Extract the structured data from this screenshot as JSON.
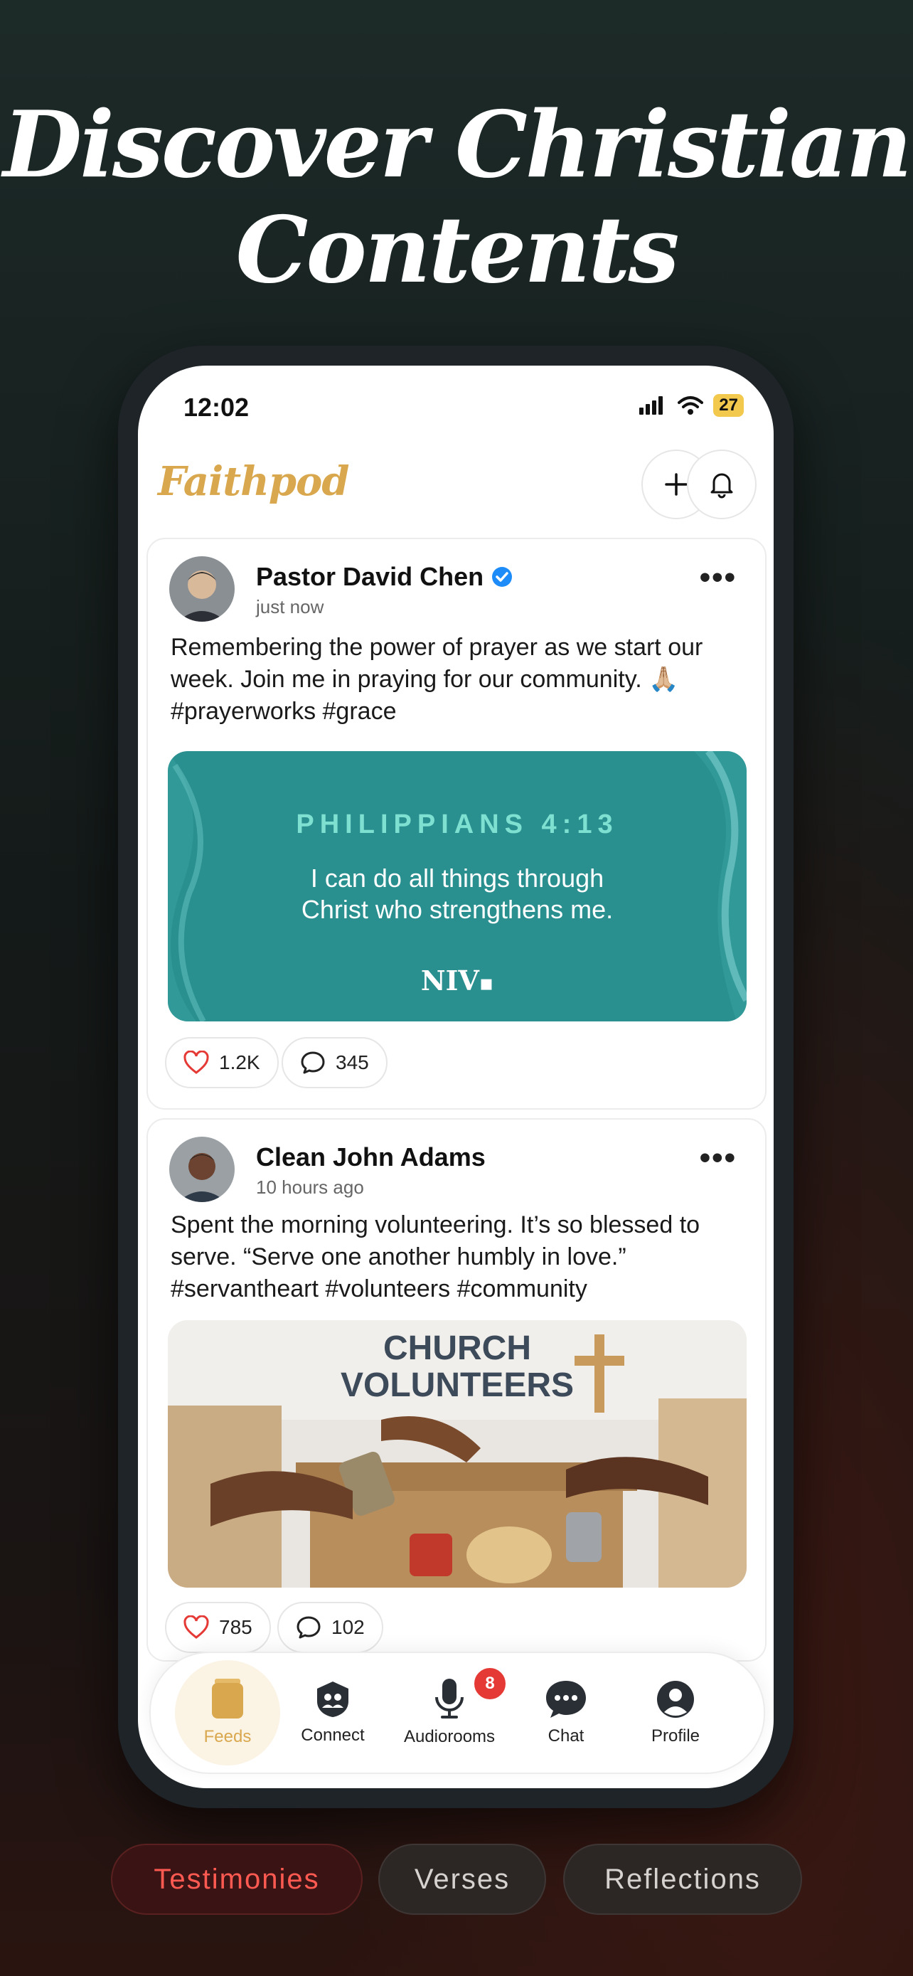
{
  "headline": {
    "line1": "Discover Christian",
    "line2": "Contents"
  },
  "status_bar": {
    "time": "12:02",
    "battery": "27"
  },
  "app": {
    "brand": "Faithpod"
  },
  "posts": [
    {
      "author": "Pastor David Chen",
      "verified": true,
      "time": "just now",
      "text": "Remembering the power of prayer as we start our week. Join me in praying for our community. 🙏🏼 #prayerworks #grace",
      "verse_card": {
        "reference": "PHILIPPIANS 4:13",
        "line1": "I can do all things through",
        "line2": "Christ who strengthens me.",
        "version": "NIV"
      },
      "likes": "1.2K",
      "comments": "345"
    },
    {
      "author": "Clean John Adams",
      "verified": false,
      "time": "10 hours ago",
      "text": "Spent the morning volunteering. It’s so blessed to serve. “Serve one another humbly in love.” #servantheart #volunteers #community",
      "image_sign": {
        "line1": "CHURCH",
        "line2": "VOLUNTEERS"
      },
      "likes": "785",
      "comments": "102"
    }
  ],
  "tabbar": {
    "items": [
      {
        "label": "Feeds",
        "icon": "feeds-icon",
        "active": true
      },
      {
        "label": "Connect",
        "icon": "connect-icon"
      },
      {
        "label": "Audiorooms",
        "icon": "mic-icon",
        "badge": "8"
      },
      {
        "label": "Chat",
        "icon": "chat-icon"
      },
      {
        "label": "Profile",
        "icon": "profile-icon"
      }
    ]
  },
  "categories": [
    "Testimonies",
    "Verses",
    "Reflections"
  ],
  "colors": {
    "accent": "#d9a84e",
    "teal": "#2a8f8f",
    "red": "#e53935",
    "verified": "#1d8cf8"
  }
}
